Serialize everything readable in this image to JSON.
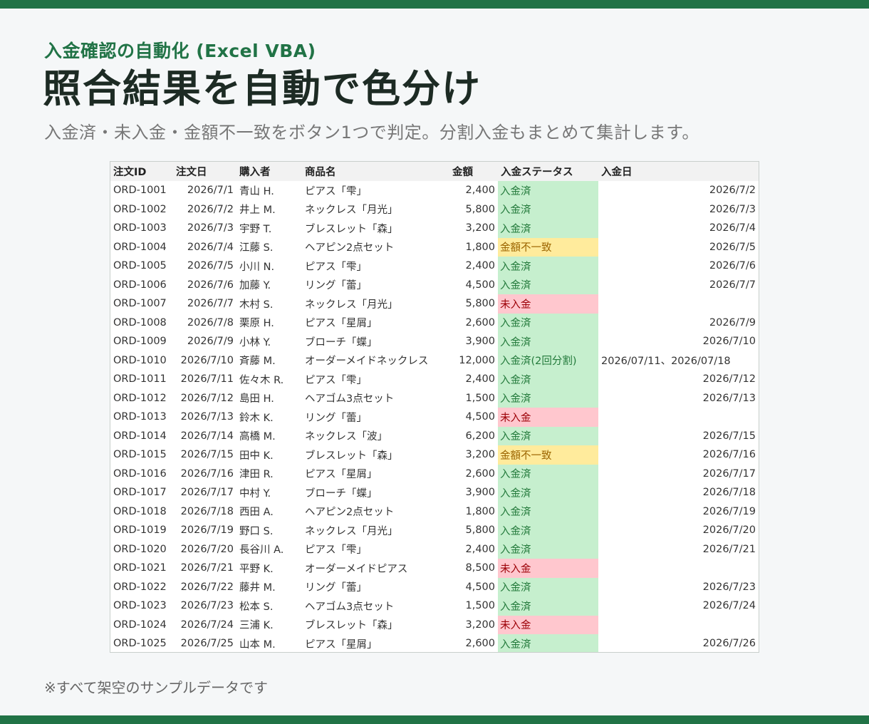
{
  "header": {
    "eyebrow": "入金確認の自動化 (Excel VBA)",
    "title": "照合結果を自動で色分け",
    "subtitle": "入金済・未入金・金額不一致をボタン1つで判定。分割入金もまとめて集計します。"
  },
  "footer": {
    "note": "※すべて架空のサンプルデータです"
  },
  "colors": {
    "brand": "#217346",
    "paid_bg": "#c6efce",
    "mismatch_bg": "#ffeb9c",
    "unpaid_bg": "#ffc7ce"
  },
  "table": {
    "columns": [
      "注文ID",
      "注文日",
      "購入者",
      "商品名",
      "金額",
      "入金ステータス",
      "入金日"
    ],
    "rows": [
      {
        "id": "ORD-1001",
        "date": "2026/7/1",
        "buyer": "青山 H.",
        "item": "ピアス「雫」",
        "amount": "2,400",
        "status": "入金済",
        "kind": "ok",
        "paid": "2026/7/2"
      },
      {
        "id": "ORD-1002",
        "date": "2026/7/2",
        "buyer": "井上 M.",
        "item": "ネックレス「月光」",
        "amount": "5,800",
        "status": "入金済",
        "kind": "ok",
        "paid": "2026/7/3"
      },
      {
        "id": "ORD-1003",
        "date": "2026/7/3",
        "buyer": "宇野 T.",
        "item": "ブレスレット「森」",
        "amount": "3,200",
        "status": "入金済",
        "kind": "ok",
        "paid": "2026/7/4"
      },
      {
        "id": "ORD-1004",
        "date": "2026/7/4",
        "buyer": "江藤 S.",
        "item": "ヘアピン2点セット",
        "amount": "1,800",
        "status": "金額不一致",
        "kind": "mis",
        "paid": "2026/7/5"
      },
      {
        "id": "ORD-1005",
        "date": "2026/7/5",
        "buyer": "小川 N.",
        "item": "ピアス「雫」",
        "amount": "2,400",
        "status": "入金済",
        "kind": "ok",
        "paid": "2026/7/6"
      },
      {
        "id": "ORD-1006",
        "date": "2026/7/6",
        "buyer": "加藤 Y.",
        "item": "リング「蕾」",
        "amount": "4,500",
        "status": "入金済",
        "kind": "ok",
        "paid": "2026/7/7"
      },
      {
        "id": "ORD-1007",
        "date": "2026/7/7",
        "buyer": "木村 S.",
        "item": "ネックレス「月光」",
        "amount": "5,800",
        "status": "未入金",
        "kind": "un",
        "paid": ""
      },
      {
        "id": "ORD-1008",
        "date": "2026/7/8",
        "buyer": "栗原 H.",
        "item": "ピアス「星屑」",
        "amount": "2,600",
        "status": "入金済",
        "kind": "ok",
        "paid": "2026/7/9"
      },
      {
        "id": "ORD-1009",
        "date": "2026/7/9",
        "buyer": "小林 Y.",
        "item": "ブローチ「蝶」",
        "amount": "3,900",
        "status": "入金済",
        "kind": "ok",
        "paid": "2026/7/10"
      },
      {
        "id": "ORD-1010",
        "date": "2026/7/10",
        "buyer": "斉藤 M.",
        "item": "オーダーメイドネックレス",
        "amount": "12,000",
        "status": "入金済(2回分割)",
        "kind": "ok",
        "paid": "2026/07/11、2026/07/18",
        "multi": true
      },
      {
        "id": "ORD-1011",
        "date": "2026/7/11",
        "buyer": "佐々木 R.",
        "item": "ピアス「雫」",
        "amount": "2,400",
        "status": "入金済",
        "kind": "ok",
        "paid": "2026/7/12"
      },
      {
        "id": "ORD-1012",
        "date": "2026/7/12",
        "buyer": "島田 H.",
        "item": "ヘアゴム3点セット",
        "amount": "1,500",
        "status": "入金済",
        "kind": "ok",
        "paid": "2026/7/13"
      },
      {
        "id": "ORD-1013",
        "date": "2026/7/13",
        "buyer": "鈴木 K.",
        "item": "リング「蕾」",
        "amount": "4,500",
        "status": "未入金",
        "kind": "un",
        "paid": ""
      },
      {
        "id": "ORD-1014",
        "date": "2026/7/14",
        "buyer": "高橋 M.",
        "item": "ネックレス「波」",
        "amount": "6,200",
        "status": "入金済",
        "kind": "ok",
        "paid": "2026/7/15"
      },
      {
        "id": "ORD-1015",
        "date": "2026/7/15",
        "buyer": "田中 K.",
        "item": "ブレスレット「森」",
        "amount": "3,200",
        "status": "金額不一致",
        "kind": "mis",
        "paid": "2026/7/16"
      },
      {
        "id": "ORD-1016",
        "date": "2026/7/16",
        "buyer": "津田 R.",
        "item": "ピアス「星屑」",
        "amount": "2,600",
        "status": "入金済",
        "kind": "ok",
        "paid": "2026/7/17"
      },
      {
        "id": "ORD-1017",
        "date": "2026/7/17",
        "buyer": "中村 Y.",
        "item": "ブローチ「蝶」",
        "amount": "3,900",
        "status": "入金済",
        "kind": "ok",
        "paid": "2026/7/18"
      },
      {
        "id": "ORD-1018",
        "date": "2026/7/18",
        "buyer": "西田 A.",
        "item": "ヘアピン2点セット",
        "amount": "1,800",
        "status": "入金済",
        "kind": "ok",
        "paid": "2026/7/19"
      },
      {
        "id": "ORD-1019",
        "date": "2026/7/19",
        "buyer": "野口 S.",
        "item": "ネックレス「月光」",
        "amount": "5,800",
        "status": "入金済",
        "kind": "ok",
        "paid": "2026/7/20"
      },
      {
        "id": "ORD-1020",
        "date": "2026/7/20",
        "buyer": "長谷川 A.",
        "item": "ピアス「雫」",
        "amount": "2,400",
        "status": "入金済",
        "kind": "ok",
        "paid": "2026/7/21"
      },
      {
        "id": "ORD-1021",
        "date": "2026/7/21",
        "buyer": "平野 K.",
        "item": "オーダーメイドピアス",
        "amount": "8,500",
        "status": "未入金",
        "kind": "un",
        "paid": ""
      },
      {
        "id": "ORD-1022",
        "date": "2026/7/22",
        "buyer": "藤井 M.",
        "item": "リング「蕾」",
        "amount": "4,500",
        "status": "入金済",
        "kind": "ok",
        "paid": "2026/7/23"
      },
      {
        "id": "ORD-1023",
        "date": "2026/7/23",
        "buyer": "松本 S.",
        "item": "ヘアゴム3点セット",
        "amount": "1,500",
        "status": "入金済",
        "kind": "ok",
        "paid": "2026/7/24"
      },
      {
        "id": "ORD-1024",
        "date": "2026/7/24",
        "buyer": "三浦 K.",
        "item": "ブレスレット「森」",
        "amount": "3,200",
        "status": "未入金",
        "kind": "un",
        "paid": ""
      },
      {
        "id": "ORD-1025",
        "date": "2026/7/25",
        "buyer": "山本 M.",
        "item": "ピアス「星屑」",
        "amount": "2,600",
        "status": "入金済",
        "kind": "ok",
        "paid": "2026/7/26"
      }
    ]
  }
}
